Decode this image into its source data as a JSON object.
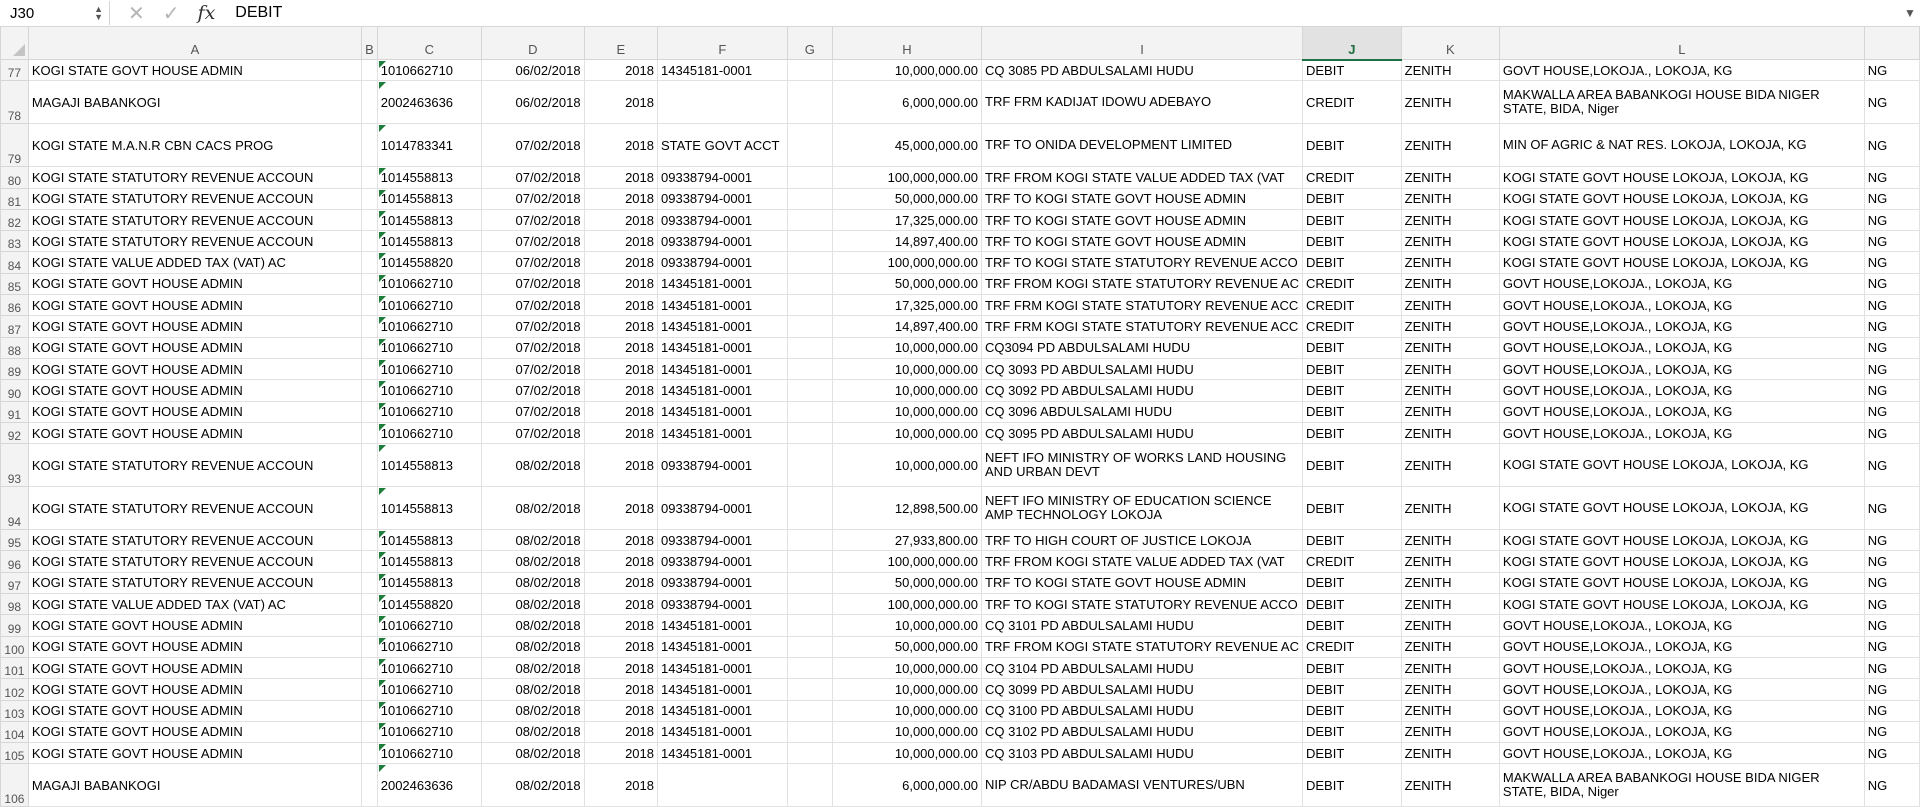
{
  "formula_bar": {
    "name_box": "J30",
    "cancel_icon": "cancel-icon",
    "enter_icon": "check-icon",
    "fx_label": "fx",
    "value": "DEBIT"
  },
  "columns": [
    "A",
    "B",
    "C",
    "D",
    "E",
    "F",
    "G",
    "H",
    "I",
    "J",
    "K",
    "L",
    ""
  ],
  "selected_column": "J",
  "rows": [
    {
      "n": "77",
      "a": "KOGI STATE GOVT HOUSE ADMIN",
      "c": "1010662710",
      "d": "06/02/2018",
      "e": "2018",
      "f": "14345181-0001",
      "h": "10,000,000.00",
      "i": "CQ 3085 PD ABDULSALAMI HUDU",
      "j": "DEBIT",
      "k": "ZENITH",
      "l": "GOVT HOUSE,LOKOJA., LOKOJA, KG",
      "m": "NG"
    },
    {
      "n": "78",
      "a": "MAGAJI BABANKOGI",
      "c": "2002463636",
      "d": "06/02/2018",
      "e": "2018",
      "f": "",
      "h": "6,000,000.00",
      "i": "TRF FRM KADIJAT IDOWU ADEBAYO",
      "j": "CREDIT",
      "k": "ZENITH",
      "l": "MAKWALLA AREA BABANKOGI HOUSE BIDA NIGER STATE, BIDA, Niger",
      "m": "NG",
      "tall": true
    },
    {
      "n": "79",
      "a": "KOGI STATE M.A.N.R CBN CACS PROG",
      "c": "1014783341",
      "d": "07/02/2018",
      "e": "2018",
      "f": "STATE GOVT ACCT",
      "h": "45,000,000.00",
      "i": "TRF TO ONIDA DEVELOPMENT LIMITED",
      "j": "DEBIT",
      "k": "ZENITH",
      "l": "MIN OF AGRIC & NAT RES. LOKOJA, LOKOJA, KG",
      "m": "NG",
      "tall": true
    },
    {
      "n": "80",
      "a": "KOGI STATE STATUTORY REVENUE ACCOUN",
      "c": "1014558813",
      "d": "07/02/2018",
      "e": "2018",
      "f": "09338794-0001",
      "h": "100,000,000.00",
      "i": "TRF FROM KOGI STATE VALUE ADDED TAX (VAT",
      "j": "CREDIT",
      "k": "ZENITH",
      "l": "KOGI STATE GOVT HOUSE LOKOJA, LOKOJA, KG",
      "m": "NG"
    },
    {
      "n": "81",
      "a": "KOGI STATE STATUTORY REVENUE ACCOUN",
      "c": "1014558813",
      "d": "07/02/2018",
      "e": "2018",
      "f": "09338794-0001",
      "h": "50,000,000.00",
      "i": "TRF TO KOGI STATE GOVT HOUSE ADMIN",
      "j": "DEBIT",
      "k": "ZENITH",
      "l": "KOGI STATE GOVT HOUSE LOKOJA, LOKOJA, KG",
      "m": "NG"
    },
    {
      "n": "82",
      "a": "KOGI STATE STATUTORY REVENUE ACCOUN",
      "c": "1014558813",
      "d": "07/02/2018",
      "e": "2018",
      "f": "09338794-0001",
      "h": "17,325,000.00",
      "i": "TRF TO KOGI STATE GOVT HOUSE ADMIN",
      "j": "DEBIT",
      "k": "ZENITH",
      "l": "KOGI STATE GOVT HOUSE LOKOJA, LOKOJA, KG",
      "m": "NG"
    },
    {
      "n": "83",
      "a": "KOGI STATE STATUTORY REVENUE ACCOUN",
      "c": "1014558813",
      "d": "07/02/2018",
      "e": "2018",
      "f": "09338794-0001",
      "h": "14,897,400.00",
      "i": "TRF TO KOGI STATE GOVT HOUSE ADMIN",
      "j": "DEBIT",
      "k": "ZENITH",
      "l": "KOGI STATE GOVT HOUSE LOKOJA, LOKOJA, KG",
      "m": "NG"
    },
    {
      "n": "84",
      "a": "KOGI STATE VALUE ADDED TAX (VAT) AC",
      "c": "1014558820",
      "d": "07/02/2018",
      "e": "2018",
      "f": "09338794-0001",
      "h": "100,000,000.00",
      "i": "TRF TO KOGI STATE STATUTORY REVENUE ACCO",
      "j": "DEBIT",
      "k": "ZENITH",
      "l": "KOGI STATE GOVT HOUSE LOKOJA, LOKOJA, KG",
      "m": "NG"
    },
    {
      "n": "85",
      "a": "KOGI STATE GOVT HOUSE ADMIN",
      "c": "1010662710",
      "d": "07/02/2018",
      "e": "2018",
      "f": "14345181-0001",
      "h": "50,000,000.00",
      "i": "TRF FROM KOGI STATE STATUTORY REVENUE AC",
      "j": "CREDIT",
      "k": "ZENITH",
      "l": "GOVT HOUSE,LOKOJA., LOKOJA, KG",
      "m": "NG"
    },
    {
      "n": "86",
      "a": "KOGI STATE GOVT HOUSE ADMIN",
      "c": "1010662710",
      "d": "07/02/2018",
      "e": "2018",
      "f": "14345181-0001",
      "h": "17,325,000.00",
      "i": "TRF FRM KOGI STATE STATUTORY REVENUE ACC",
      "j": "CREDIT",
      "k": "ZENITH",
      "l": "GOVT HOUSE,LOKOJA., LOKOJA, KG",
      "m": "NG"
    },
    {
      "n": "87",
      "a": "KOGI STATE GOVT HOUSE ADMIN",
      "c": "1010662710",
      "d": "07/02/2018",
      "e": "2018",
      "f": "14345181-0001",
      "h": "14,897,400.00",
      "i": "TRF FRM KOGI STATE STATUTORY REVENUE ACC",
      "j": "CREDIT",
      "k": "ZENITH",
      "l": "GOVT HOUSE,LOKOJA., LOKOJA, KG",
      "m": "NG"
    },
    {
      "n": "88",
      "a": "KOGI STATE GOVT HOUSE ADMIN",
      "c": "1010662710",
      "d": "07/02/2018",
      "e": "2018",
      "f": "14345181-0001",
      "h": "10,000,000.00",
      "i": "CQ3094 PD ABDULSALAMI HUDU",
      "j": "DEBIT",
      "k": "ZENITH",
      "l": "GOVT HOUSE,LOKOJA., LOKOJA, KG",
      "m": "NG"
    },
    {
      "n": "89",
      "a": "KOGI STATE GOVT HOUSE ADMIN",
      "c": "1010662710",
      "d": "07/02/2018",
      "e": "2018",
      "f": "14345181-0001",
      "h": "10,000,000.00",
      "i": "CQ 3093 PD ABDULSALAMI HUDU",
      "j": "DEBIT",
      "k": "ZENITH",
      "l": "GOVT HOUSE,LOKOJA., LOKOJA, KG",
      "m": "NG"
    },
    {
      "n": "90",
      "a": "KOGI STATE GOVT HOUSE ADMIN",
      "c": "1010662710",
      "d": "07/02/2018",
      "e": "2018",
      "f": "14345181-0001",
      "h": "10,000,000.00",
      "i": "CQ 3092 PD ABDULSALAMI HUDU",
      "j": "DEBIT",
      "k": "ZENITH",
      "l": "GOVT HOUSE,LOKOJA., LOKOJA, KG",
      "m": "NG"
    },
    {
      "n": "91",
      "a": "KOGI STATE GOVT HOUSE ADMIN",
      "c": "1010662710",
      "d": "07/02/2018",
      "e": "2018",
      "f": "14345181-0001",
      "h": "10,000,000.00",
      "i": "CQ 3096 ABDULSALAMI HUDU",
      "j": "DEBIT",
      "k": "ZENITH",
      "l": "GOVT HOUSE,LOKOJA., LOKOJA, KG",
      "m": "NG"
    },
    {
      "n": "92",
      "a": "KOGI STATE GOVT HOUSE ADMIN",
      "c": "1010662710",
      "d": "07/02/2018",
      "e": "2018",
      "f": "14345181-0001",
      "h": "10,000,000.00",
      "i": "CQ 3095 PD ABDULSALAMI HUDU",
      "j": "DEBIT",
      "k": "ZENITH",
      "l": "GOVT HOUSE,LOKOJA., LOKOJA, KG",
      "m": "NG"
    },
    {
      "n": "93",
      "a": "KOGI STATE STATUTORY REVENUE ACCOUN",
      "c": "1014558813",
      "d": "08/02/2018",
      "e": "2018",
      "f": "09338794-0001",
      "h": "10,000,000.00",
      "i": "NEFT IFO MINISTRY OF WORKS LAND HOUSING AND URBAN DEVT",
      "j": "DEBIT",
      "k": "ZENITH",
      "l": "KOGI STATE GOVT HOUSE LOKOJA, LOKOJA, KG",
      "m": "NG",
      "tall": true
    },
    {
      "n": "94",
      "a": "KOGI STATE STATUTORY REVENUE ACCOUN",
      "c": "1014558813",
      "d": "08/02/2018",
      "e": "2018",
      "f": "09338794-0001",
      "h": "12,898,500.00",
      "i": "NEFT IFO MINISTRY OF EDUCATION SCIENCE AMP TECHNOLOGY LOKOJA",
      "j": "DEBIT",
      "k": "ZENITH",
      "l": "KOGI STATE GOVT HOUSE LOKOJA, LOKOJA, KG",
      "m": "NG",
      "tall": true
    },
    {
      "n": "95",
      "a": "KOGI STATE STATUTORY REVENUE ACCOUN",
      "c": "1014558813",
      "d": "08/02/2018",
      "e": "2018",
      "f": "09338794-0001",
      "h": "27,933,800.00",
      "i": "TRF TO HIGH COURT OF JUSTICE LOKOJA",
      "j": "DEBIT",
      "k": "ZENITH",
      "l": "KOGI STATE GOVT HOUSE LOKOJA, LOKOJA, KG",
      "m": "NG"
    },
    {
      "n": "96",
      "a": "KOGI STATE STATUTORY REVENUE ACCOUN",
      "c": "1014558813",
      "d": "08/02/2018",
      "e": "2018",
      "f": "09338794-0001",
      "h": "100,000,000.00",
      "i": "TRF FROM KOGI STATE VALUE ADDED TAX (VAT",
      "j": "CREDIT",
      "k": "ZENITH",
      "l": "KOGI STATE GOVT HOUSE LOKOJA, LOKOJA, KG",
      "m": "NG"
    },
    {
      "n": "97",
      "a": "KOGI STATE STATUTORY REVENUE ACCOUN",
      "c": "1014558813",
      "d": "08/02/2018",
      "e": "2018",
      "f": "09338794-0001",
      "h": "50,000,000.00",
      "i": "TRF TO KOGI STATE GOVT HOUSE ADMIN",
      "j": "DEBIT",
      "k": "ZENITH",
      "l": "KOGI STATE GOVT HOUSE LOKOJA, LOKOJA, KG",
      "m": "NG"
    },
    {
      "n": "98",
      "a": "KOGI STATE VALUE ADDED TAX (VAT) AC",
      "c": "1014558820",
      "d": "08/02/2018",
      "e": "2018",
      "f": "09338794-0001",
      "h": "100,000,000.00",
      "i": "TRF TO KOGI STATE STATUTORY REVENUE ACCO",
      "j": "DEBIT",
      "k": "ZENITH",
      "l": "KOGI STATE GOVT HOUSE LOKOJA, LOKOJA, KG",
      "m": "NG"
    },
    {
      "n": "99",
      "a": "KOGI STATE GOVT HOUSE ADMIN",
      "c": "1010662710",
      "d": "08/02/2018",
      "e": "2018",
      "f": "14345181-0001",
      "h": "10,000,000.00",
      "i": "CQ 3101 PD ABDULSALAMI HUDU",
      "j": "DEBIT",
      "k": "ZENITH",
      "l": "GOVT HOUSE,LOKOJA., LOKOJA, KG",
      "m": "NG"
    },
    {
      "n": "100",
      "a": "KOGI STATE GOVT HOUSE ADMIN",
      "c": "1010662710",
      "d": "08/02/2018",
      "e": "2018",
      "f": "14345181-0001",
      "h": "50,000,000.00",
      "i": "TRF FROM KOGI STATE STATUTORY REVENUE AC",
      "j": "CREDIT",
      "k": "ZENITH",
      "l": "GOVT HOUSE,LOKOJA., LOKOJA, KG",
      "m": "NG"
    },
    {
      "n": "101",
      "a": "KOGI STATE GOVT HOUSE ADMIN",
      "c": "1010662710",
      "d": "08/02/2018",
      "e": "2018",
      "f": "14345181-0001",
      "h": "10,000,000.00",
      "i": "CQ 3104 PD ABDULSALAMI HUDU",
      "j": "DEBIT",
      "k": "ZENITH",
      "l": "GOVT HOUSE,LOKOJA., LOKOJA, KG",
      "m": "NG"
    },
    {
      "n": "102",
      "a": "KOGI STATE GOVT HOUSE ADMIN",
      "c": "1010662710",
      "d": "08/02/2018",
      "e": "2018",
      "f": "14345181-0001",
      "h": "10,000,000.00",
      "i": "CQ 3099 PD ABDULSALAMI HUDU",
      "j": "DEBIT",
      "k": "ZENITH",
      "l": "GOVT HOUSE,LOKOJA., LOKOJA, KG",
      "m": "NG"
    },
    {
      "n": "103",
      "a": "KOGI STATE GOVT HOUSE ADMIN",
      "c": "1010662710",
      "d": "08/02/2018",
      "e": "2018",
      "f": "14345181-0001",
      "h": "10,000,000.00",
      "i": "CQ 3100 PD ABDULSALAMI HUDU",
      "j": "DEBIT",
      "k": "ZENITH",
      "l": "GOVT HOUSE,LOKOJA., LOKOJA, KG",
      "m": "NG"
    },
    {
      "n": "104",
      "a": "KOGI STATE GOVT HOUSE ADMIN",
      "c": "1010662710",
      "d": "08/02/2018",
      "e": "2018",
      "f": "14345181-0001",
      "h": "10,000,000.00",
      "i": "CQ 3102 PD ABDULSALAMI HUDU",
      "j": "DEBIT",
      "k": "ZENITH",
      "l": "GOVT HOUSE,LOKOJA., LOKOJA, KG",
      "m": "NG"
    },
    {
      "n": "105",
      "a": "KOGI STATE GOVT HOUSE ADMIN",
      "c": "1010662710",
      "d": "08/02/2018",
      "e": "2018",
      "f": "14345181-0001",
      "h": "10,000,000.00",
      "i": "CQ 3103 PD ABDULSALAMI HUDU",
      "j": "DEBIT",
      "k": "ZENITH",
      "l": "GOVT HOUSE,LOKOJA., LOKOJA, KG",
      "m": "NG"
    },
    {
      "n": "106",
      "a": "MAGAJI BABANKOGI",
      "c": "2002463636",
      "d": "08/02/2018",
      "e": "2018",
      "f": "",
      "h": "6,000,000.00",
      "i": "NIP CR/ABDU BADAMASI VENTURES/UBN",
      "j": "DEBIT",
      "k": "ZENITH",
      "l": "MAKWALLA AREA BABANKOGI HOUSE BIDA NIGER STATE, BIDA, Niger",
      "m": "NG",
      "tall": true
    }
  ]
}
